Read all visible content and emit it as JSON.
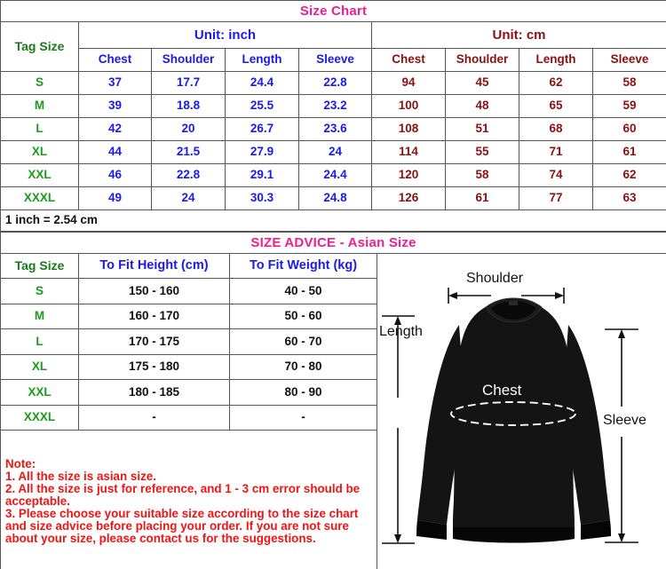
{
  "size_chart": {
    "title": "Size Chart",
    "tag_size_header": "Tag Size",
    "unit_inch": "Unit: inch",
    "unit_cm": "Unit: cm",
    "columns": [
      "Chest",
      "Shoulder",
      "Length",
      "Sleeve"
    ],
    "rows": [
      {
        "tag": "S",
        "inch": [
          "37",
          "17.7",
          "24.4",
          "22.8"
        ],
        "cm": [
          "94",
          "45",
          "62",
          "58"
        ]
      },
      {
        "tag": "M",
        "inch": [
          "39",
          "18.8",
          "25.5",
          "23.2"
        ],
        "cm": [
          "100",
          "48",
          "65",
          "59"
        ]
      },
      {
        "tag": "L",
        "inch": [
          "42",
          "20",
          "26.7",
          "23.6"
        ],
        "cm": [
          "108",
          "51",
          "68",
          "60"
        ]
      },
      {
        "tag": "XL",
        "inch": [
          "44",
          "21.5",
          "27.9",
          "24"
        ],
        "cm": [
          "114",
          "55",
          "71",
          "61"
        ]
      },
      {
        "tag": "XXL",
        "inch": [
          "46",
          "22.8",
          "29.1",
          "24.4"
        ],
        "cm": [
          "120",
          "58",
          "74",
          "62"
        ]
      },
      {
        "tag": "XXXL",
        "inch": [
          "49",
          "24",
          "30.3",
          "24.8"
        ],
        "cm": [
          "126",
          "61",
          "77",
          "63"
        ]
      }
    ],
    "conversion_note": "1 inch = 2.54 cm"
  },
  "size_advice": {
    "title": "SIZE ADVICE - Asian Size",
    "tag_size_header": "Tag Size",
    "height_header": "To Fit Height (cm)",
    "weight_header": "To Fit Weight (kg)",
    "rows": [
      {
        "tag": "S",
        "height": "150 - 160",
        "weight": "40 - 50"
      },
      {
        "tag": "M",
        "height": "160 - 170",
        "weight": "50 - 60"
      },
      {
        "tag": "L",
        "height": "170 - 175",
        "weight": "60 - 70"
      },
      {
        "tag": "XL",
        "height": "175 - 180",
        "weight": "70 - 80"
      },
      {
        "tag": "XXL",
        "height": "180 - 185",
        "weight": "80 - 90"
      },
      {
        "tag": "XXXL",
        "height": "-",
        "weight": "-"
      }
    ]
  },
  "note": {
    "heading": "Note:",
    "line1": "1. All the size is asian size.",
    "line2": "2. All the size is just for reference, and 1 - 3 cm error should be acceptable.",
    "line3": "3. Please choose your suitable size according to the size chart and size advice before placing your order. If you are not sure about your size, please contact us for the suggestions."
  },
  "illustration": {
    "length_label": "Length",
    "shoulder_label": "Shoulder",
    "chest_label": "Chest",
    "sleeve_label": "Sleeve",
    "garment_color": "#111111",
    "dimension_line_color": "#111111"
  },
  "colors": {
    "title_pink": "#ed1e91",
    "inch_blue": "#1a1aee",
    "cm_darkred": "#8b1010",
    "tag_green": "#1a9c1a",
    "note_red": "#f01414",
    "border_gray": "#555555"
  }
}
